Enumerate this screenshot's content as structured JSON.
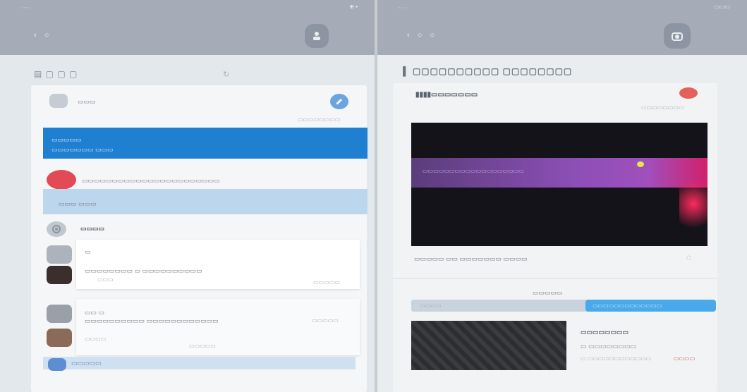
{
  "left_pane": {
    "status_time": "∙∙∙∙",
    "status_icons": "⊕ ▪",
    "nav_icons": "‹ ○",
    "corner_icon": "person-icon",
    "heading": "▤ ▢ ▢ ▢",
    "top_card": {
      "title": "▭▭▭",
      "right_text": "▭▭▭▭▭▭▭▭"
    },
    "selected_row": {
      "title": "▭▭▭▭▭",
      "subtitle": "▭▭▭▭▭▭▭ ▭▭▭"
    },
    "items": [
      {
        "title": "▭▭▭▭▭▭▭▭▭▭▭▭▭▭▭▭▭▭▭▭▭▭▭",
        "subtitle": "▭▭▭ ▭▭▭",
        "color": "#e24b55"
      },
      {
        "title": "▭▭▭▭",
        "color": "#b9bfc7"
      }
    ],
    "sub_card_1": {
      "line1": "▭",
      "line2": "▭▭▭▭▭▭▭▭ ▭ ▭▭▭▭▭▭▭▭▭▭",
      "line3": "▭▭▭",
      "action": "▭▭▭▭▭"
    },
    "sub_card_2": {
      "line1": "▭▭ ▭",
      "line2": "▭▭▭▭▭▭▭▭▭▭ ▭▭▭▭▭▭▭▭▭▭▭▭",
      "line3": "▭▭▭▭",
      "mid": "▭▭▭▭▭",
      "action": "▭▭▭▭▭"
    },
    "bottom_row": {
      "label": "▭▭▭▭▭"
    }
  },
  "right_pane": {
    "status_time": "∙∙∙∙",
    "status_icons": "▭▭▭",
    "nav_icons": "‹ ○ ○",
    "corner_icon": "camera-icon",
    "heading": "▌ ▢▢▢▢▢▢▢▢▢▢ ▢▢▢▢▢▢▢▢",
    "card_title": "▮▮▮▮▭▭▭▭▭▭▭",
    "card_meta": "▭▭▭▭▭▭▭▭",
    "video_caption": "▭▭▭▭▭▭▭▭▭▭▭▭▭▭▭▭▭▭▭",
    "meta_row": "▭▭▭▭▭ ▭▭ ▭▭▭▭▭▭▭ ▭▭▭▭",
    "section_label": "▭▭▭▭▭",
    "toggle_left": "▭▭▭▭",
    "toggle_right": "▭▭▭▭▭▭▭▭▭▭▭▭▭",
    "thumb_title": "▭▭▭▭▭▭▭▭",
    "thumb_line": "▭ ▭▭▭▭▭▭▭▭",
    "thumb_meta": "▭ ▭▭▭▭▭▭▭▭▭▭▭▭",
    "thumb_badge": "▭▭▭▭"
  },
  "colors": {
    "topbar": "#a5acb8",
    "accent_blue": "#1f7fd1",
    "light_blue": "#bcd6ee",
    "red": "#e24b55",
    "toggle_blue": "#4aa9ea"
  }
}
